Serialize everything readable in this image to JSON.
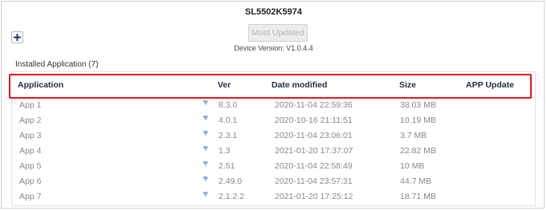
{
  "device": {
    "title": "SL5502K5974",
    "most_updated_label": "Most Updated",
    "version_text": "Device Version: V1.0.4.4"
  },
  "installed": {
    "label": "Installed Application (7)"
  },
  "table": {
    "columns": [
      "Application",
      "Ver",
      "Date modified",
      "Size",
      "APP Update"
    ],
    "rows": [
      {
        "app": "App 1",
        "ver": "8.3.0",
        "date": "2020-11-04 22:59:36",
        "size": "38.03 MB"
      },
      {
        "app": "App 2",
        "ver": "4.0.1",
        "date": "2020-10-16 21:11:51",
        "size": "10.19 MB"
      },
      {
        "app": "App 3",
        "ver": "2.3.1",
        "date": "2020-11-04 23:06:01",
        "size": "3.7 MB"
      },
      {
        "app": "App 4",
        "ver": "1.3",
        "date": "2021-01-20 17:37:07",
        "size": "22.82 MB"
      },
      {
        "app": "App 5",
        "ver": "2.51",
        "date": "2020-11-04 22:58:49",
        "size": "10 MB"
      },
      {
        "app": "App 6",
        "ver": "2.49.0",
        "date": "2020-11-04 23:57:31",
        "size": "44.7 MB"
      },
      {
        "app": "App 7",
        "ver": "2.1.2.2",
        "date": "2021-01-20 17:25:12",
        "size": "18.71 MB"
      }
    ]
  },
  "colors": {
    "highlight": "#e8141b",
    "pin_icon": "#8ab4e0"
  },
  "icons": {
    "add": "plus-icon",
    "row_marker": "pin-icon"
  }
}
